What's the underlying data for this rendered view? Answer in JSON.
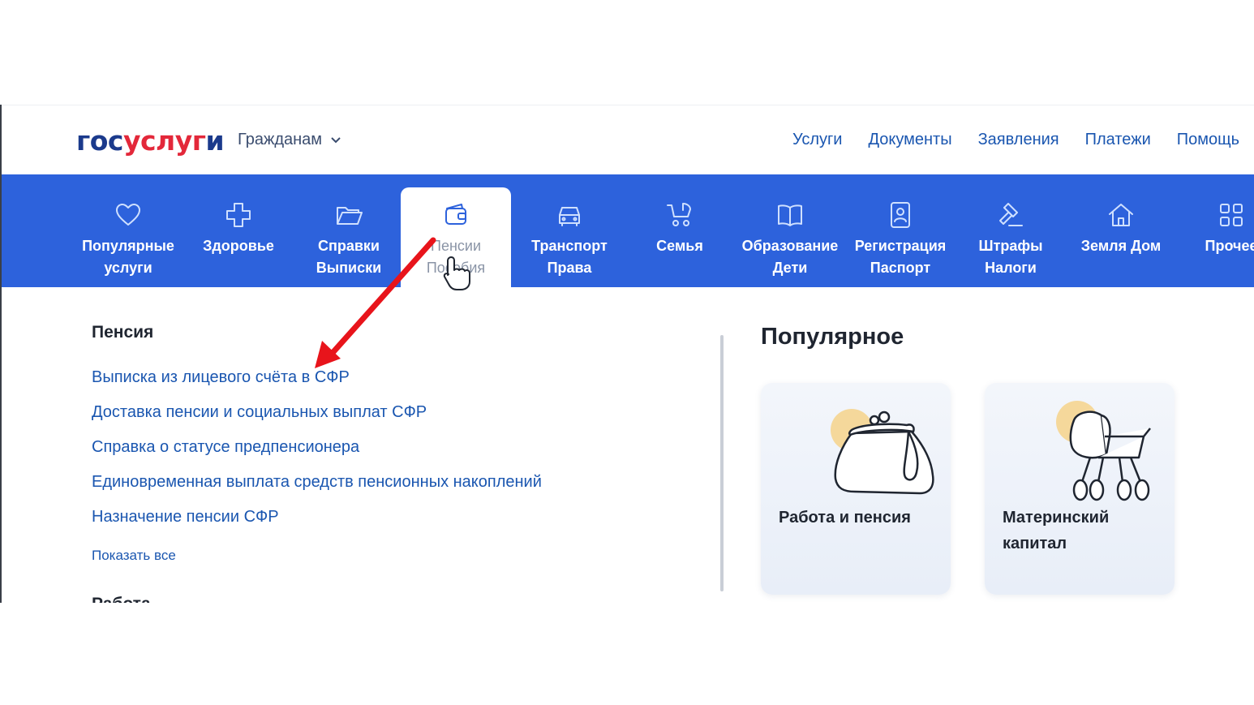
{
  "header": {
    "logo": {
      "part1": "гос",
      "part2": "услуг",
      "part3": "и"
    },
    "audience_selector": "Гражданам",
    "nav": [
      "Услуги",
      "Документы",
      "Заявления",
      "Платежи",
      "Помощь"
    ]
  },
  "categories": [
    {
      "icon": "heart-icon",
      "line1": "Популярные",
      "line2": "услуги"
    },
    {
      "icon": "cross-icon",
      "line1": "Здоровье",
      "line2": ""
    },
    {
      "icon": "folder-icon",
      "line1": "Справки",
      "line2": "Выписки"
    },
    {
      "icon": "wallet-icon",
      "line1": "Пенсии",
      "line2": "Пособия",
      "active": true
    },
    {
      "icon": "car-icon",
      "line1": "Транспорт",
      "line2": "Права"
    },
    {
      "icon": "stroller-icon",
      "line1": "Семья",
      "line2": ""
    },
    {
      "icon": "book-icon",
      "line1": "Образование",
      "line2": "Дети"
    },
    {
      "icon": "id-card-icon",
      "line1": "Регистрация",
      "line2": "Паспорт"
    },
    {
      "icon": "gavel-icon",
      "line1": "Штрафы",
      "line2": "Налоги"
    },
    {
      "icon": "house-icon",
      "line1": "Земля Дом",
      "line2": ""
    },
    {
      "icon": "grid-icon",
      "line1": "Прочее",
      "line2": ""
    }
  ],
  "pension_section": {
    "title": "Пенсия",
    "links": [
      "Выписка из лицевого счёта в СФР",
      "Доставка пенсии и социальных выплат СФР",
      "Справка о статусе предпенсионера",
      "Единовременная выплата средств пенсионных накоплений",
      "Назначение пенсии СФР"
    ],
    "show_all": "Показать все",
    "next_section_title": "Работа"
  },
  "popular": {
    "title": "Популярное",
    "cards": [
      {
        "label": "Работа и пенсия",
        "icon": "purse-icon"
      },
      {
        "label": "Материнский капитал",
        "icon": "baby-carriage-icon"
      }
    ]
  },
  "colors": {
    "brand_blue": "#2d62dc",
    "link_blue": "#1a56b0",
    "logo_blue": "#1b3a8c",
    "logo_red": "#e3283a",
    "annotation_arrow": "#e8141b"
  }
}
